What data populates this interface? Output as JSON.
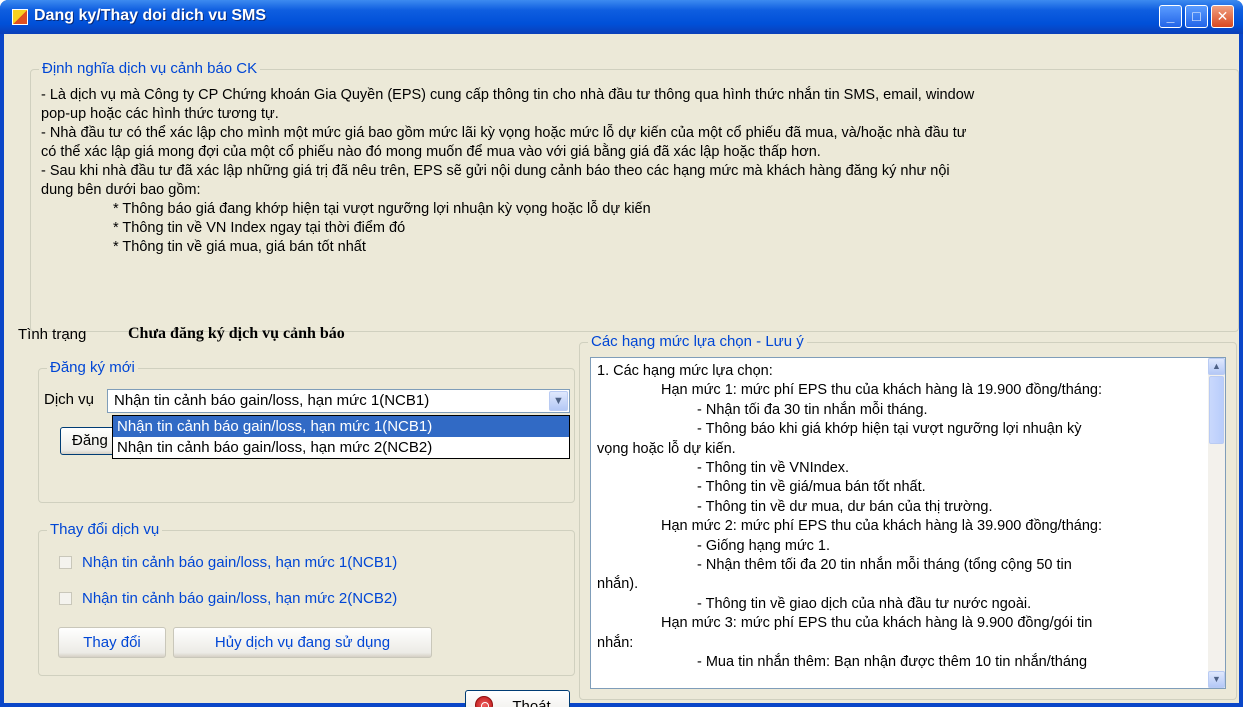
{
  "window": {
    "title": "Dang ky/Thay doi dich vu SMS",
    "minimize_glyph": "_",
    "maximize_glyph": "□",
    "close_glyph": "✕"
  },
  "definition": {
    "title": "Định nghĩa dịch vụ cảnh báo CK",
    "lines": [
      "- Là dịch vụ mà Công ty CP Chứng khoán Gia Quyền (EPS) cung cấp thông tin cho nhà đầu tư thông qua hình thức nhắn tin SMS, email, window",
      "pop-up hoặc các hình thức tương tự.",
      "- Nhà đầu tư có thể xác lập cho mình một mức giá bao gồm mức lãi kỳ vọng hoặc mức lỗ dự kiến của một cổ phiếu đã mua, và/hoặc nhà đầu tư",
      "có thể xác lập giá mong đợi của một cổ phiếu nào đó mong muốn để mua vào với giá bằng giá đã xác lập hoặc thấp hơn.",
      "- Sau khi nhà đầu tư đã xác lập những giá trị đã nêu trên, EPS sẽ gửi nội dung cảnh báo theo các hạng mức mà khách hàng đăng ký như nội",
      "dung bên dưới bao gồm:"
    ],
    "bullets": [
      "* Thông báo giá đang khớp hiện tại vượt ngưỡng lợi nhuận kỳ vọng hoặc lỗ dự kiến",
      "* Thông tin về VN Index ngay tại thời điểm đó",
      "* Thông tin về giá mua, giá bán tốt nhất"
    ]
  },
  "status": {
    "label": "Tình trạng",
    "value": "Chưa đăng ký dịch vụ cảnh báo"
  },
  "register": {
    "title": "Đăng ký mới",
    "service_label": "Dịch vụ",
    "selected": "Nhận tin cảnh báo gain/loss, hạn mức 1(NCB1)",
    "options": [
      "Nhận tin cảnh báo gain/loss, hạn mức 1(NCB1)",
      "Nhận tin cảnh báo gain/loss, hạn mức 2(NCB2)"
    ],
    "button_label": "Đăng"
  },
  "change": {
    "title": "Thay đổi dịch vụ",
    "checkboxes": [
      {
        "label": "Nhận tin cảnh báo gain/loss, hạn mức 1(NCB1)",
        "checked": false
      },
      {
        "label": "Nhận tin cảnh báo gain/loss, hạn mức 2(NCB2)",
        "checked": false
      }
    ],
    "change_button": "Thay đổi",
    "cancel_button": "Hủy dịch vụ đang sử dụng"
  },
  "exit_button": "Thoát",
  "levels": {
    "title": "Các hạng mức lựa chọn - Lưu ý",
    "lines": [
      {
        "text": "1. Các hạng mức lựa chọn:",
        "indent": 0
      },
      {
        "text": "Hạn mức 1: mức phí EPS thu của khách hàng là 19.900 đồng/tháng:",
        "indent": 1
      },
      {
        "text": "- Nhận tối đa 30 tin nhắn mỗi tháng.",
        "indent": 2
      },
      {
        "text": "- Thông báo khi giá khớp hiện tại vượt ngưỡng lợi nhuận kỳ",
        "indent": 2
      },
      {
        "text": "vọng hoặc lỗ dự kiến.",
        "indent": 0
      },
      {
        "text": "- Thông tin về VNIndex.",
        "indent": 2
      },
      {
        "text": "- Thông tin về giá/mua bán tốt nhất.",
        "indent": 2
      },
      {
        "text": "- Thông tin về dư mua, dư bán của thị trường.",
        "indent": 2
      },
      {
        "text": "Hạn mức 2: mức phí EPS thu của khách hàng là 39.900 đồng/tháng:",
        "indent": 1
      },
      {
        "text": "- Giống hạng mức 1.",
        "indent": 2
      },
      {
        "text": "- Nhận thêm tối đa 20 tin nhắn mỗi tháng (tổng cộng 50 tin",
        "indent": 2
      },
      {
        "text": "nhắn).",
        "indent": 0
      },
      {
        "text": "- Thông tin về giao dịch của nhà đầu tư nước ngoài.",
        "indent": 2
      },
      {
        "text": "Hạn mức 3: mức phí EPS thu của khách hàng là 9.900 đồng/gói tin",
        "indent": 1
      },
      {
        "text": "nhắn:",
        "indent": 0
      },
      {
        "text": "- Mua tin nhắn thêm: Bạn nhận được thêm 10 tin nhắn/tháng",
        "indent": 2
      }
    ]
  },
  "colors": {
    "titlebar": "#0054e3",
    "groupbox_title": "#0046d5",
    "window_face": "#ece9d8",
    "selection": "#316ac5"
  }
}
